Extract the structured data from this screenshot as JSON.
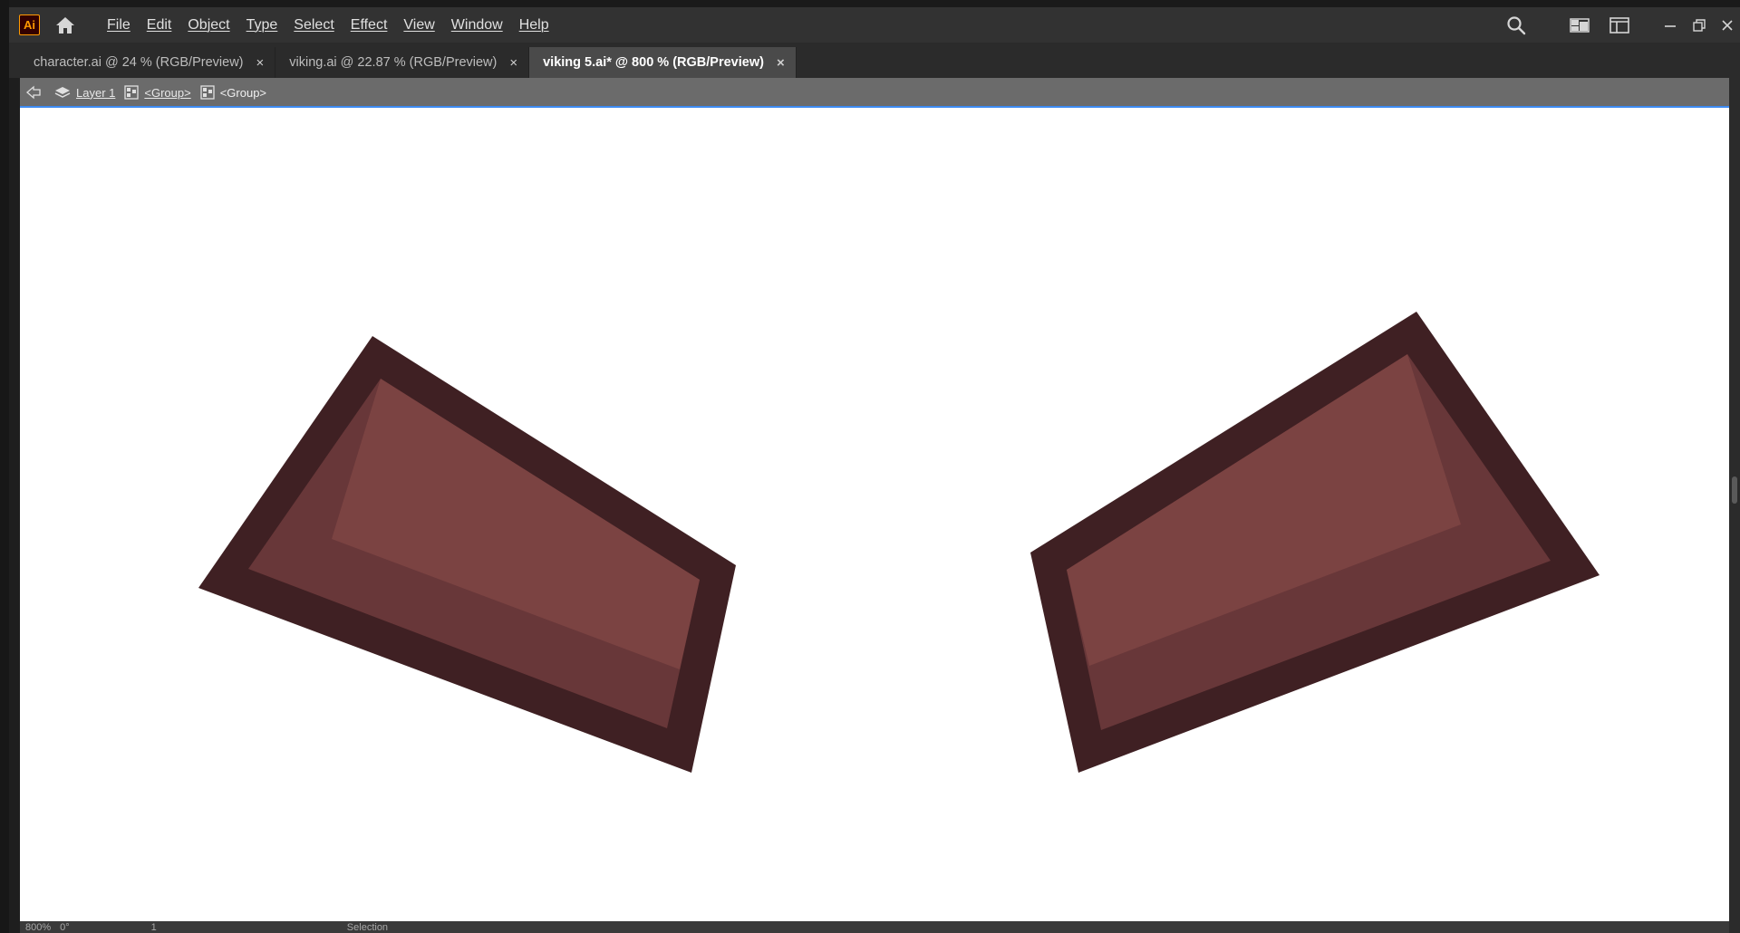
{
  "app": {
    "logo_text": "Ai",
    "brand_color": "#ff9a00"
  },
  "menus": [
    "File",
    "Edit",
    "Object",
    "Type",
    "Select",
    "Effect",
    "View",
    "Window",
    "Help"
  ],
  "header_icons": [
    "search-icon",
    "arrange-documents-icon",
    "workspace-panel-icon",
    "minimize-icon",
    "restore-icon",
    "close-icon"
  ],
  "tabs": [
    {
      "label": "character.ai @ 24 % (RGB/Preview)",
      "active": false
    },
    {
      "label": "viking.ai @ 22.87 % (RGB/Preview)",
      "active": false
    },
    {
      "label": "viking 5.ai* @ 800 % (RGB/Preview)",
      "active": true
    }
  ],
  "tab_close_glyph": "×",
  "breadcrumb": {
    "layer": "Layer 1",
    "group1": "<Group>",
    "group2": "<Group>"
  },
  "statusbar": {
    "zoom": "800%",
    "angle": "0°",
    "artboard": "1",
    "tool": "Selection"
  },
  "artwork_colors": {
    "outline": "#3f2023",
    "shadow": "#683739",
    "highlight": "#7b4342"
  }
}
